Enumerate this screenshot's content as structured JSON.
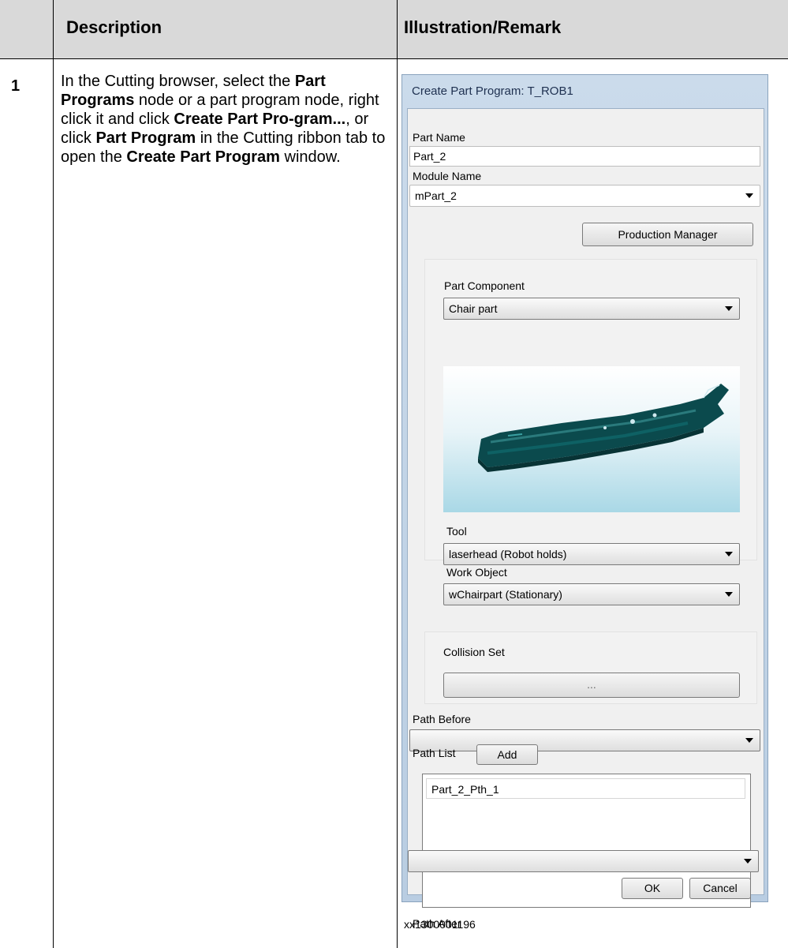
{
  "table": {
    "header_description": "Description",
    "header_illustration": "Illustration/Remark",
    "row_number": "1",
    "description": {
      "t1": "In the Cutting browser, select the ",
      "b1": "Part Programs",
      "t2": " node or a part program node, right click it and click ",
      "b2": "Create Part Pro-gram...",
      "t3": ", or click ",
      "b3": "Part Program",
      "t4": " in the Cutting ribbon tab to open the ",
      "b4": "Create Part Program",
      "t5": " window."
    },
    "caption": "xx1300001196"
  },
  "dialog": {
    "title": "Create Part Program: T_ROB1",
    "part_name_label": "Part Name",
    "part_name_value": "Part_2",
    "module_name_label": "Module Name",
    "module_name_value": "mPart_2",
    "production_manager_button": "Production Manager",
    "part_component_label": "Part Component",
    "part_component_value": "Chair part",
    "tool_label": "Tool",
    "tool_value": "laserhead (Robot holds)",
    "work_object_label": "Work Object",
    "work_object_value": "wChairpart (Stationary)",
    "collision_set_label": "Collision Set",
    "collision_set_button": "...",
    "path_before_label": "Path Before",
    "path_before_value": "",
    "path_list_label": "Path List",
    "add_button": "Add",
    "path_list_items": [
      "Part_2_Pth_1"
    ],
    "path_after_label": "Path After",
    "path_after_value": "",
    "ok_button": "OK",
    "cancel_button": "Cancel"
  }
}
